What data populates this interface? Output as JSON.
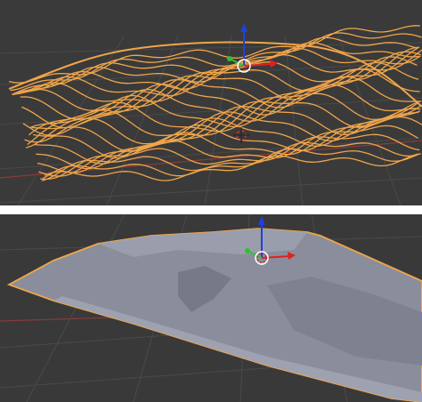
{
  "views": [
    {
      "id": "top",
      "mode": "contour-curves",
      "object_color": "#f0a54a",
      "background": "#3a3a3a",
      "grid_color": "#4a4a4a",
      "axis_x_color": "#8a3a3a"
    },
    {
      "id": "bottom",
      "mode": "solid-mesh",
      "object_color": "#8a8e9c",
      "outline_color": "#f0a54a",
      "background": "#393939",
      "grid_color": "#4a4a4a",
      "axis_x_color": "#8a3a3a"
    }
  ],
  "gizmo": {
    "z_color": "#2040e0",
    "y_color": "#30c030",
    "x_color": "#e02020",
    "center_color": "#ffffff"
  },
  "cursor_3d": {
    "colors": [
      "#c03030",
      "#ffffff"
    ]
  }
}
